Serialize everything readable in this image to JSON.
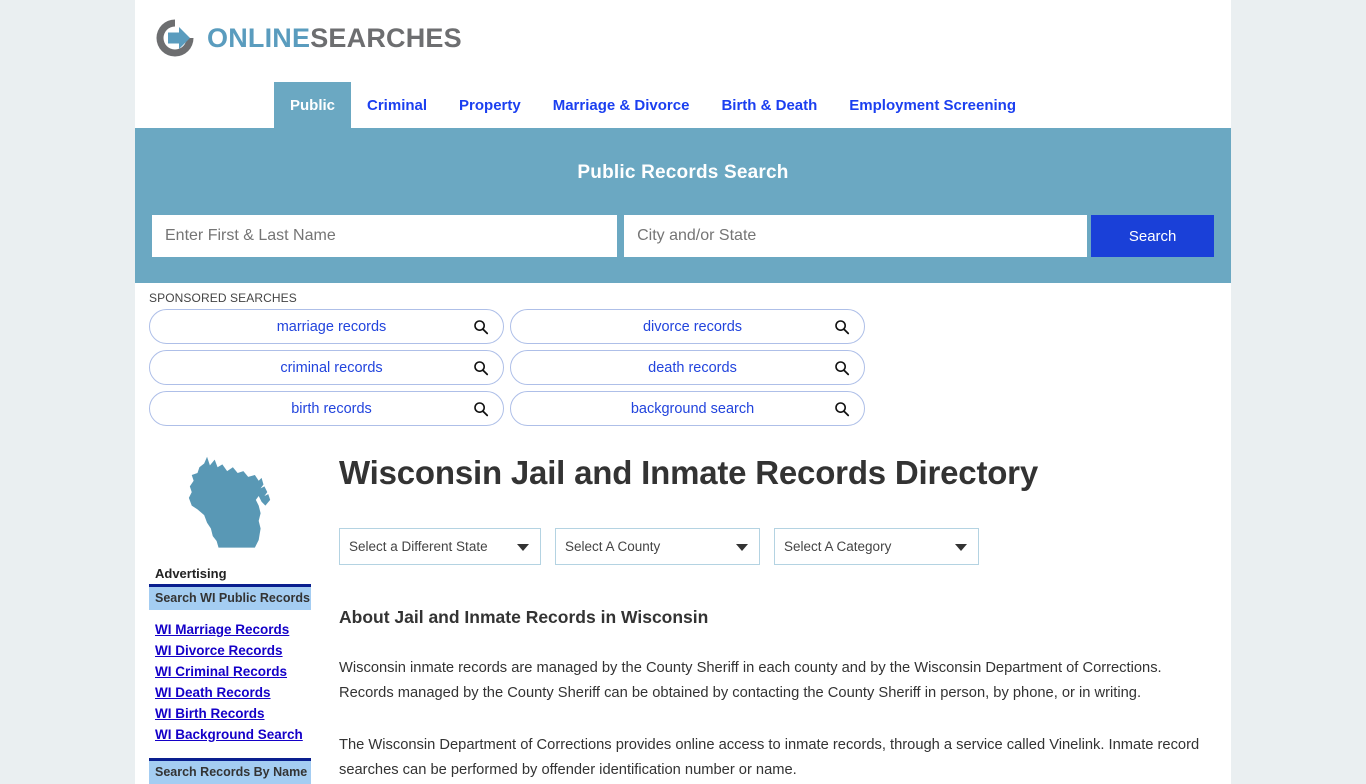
{
  "brand": {
    "name_primary": "ONLINE",
    "name_secondary": "SEARCHES",
    "logo_icon": "circle-arrow-logo"
  },
  "nav": {
    "tabs": [
      {
        "label": "Public",
        "active": true
      },
      {
        "label": "Criminal",
        "active": false
      },
      {
        "label": "Property",
        "active": false
      },
      {
        "label": "Marriage & Divorce",
        "active": false
      },
      {
        "label": "Birth & Death",
        "active": false
      },
      {
        "label": "Employment Screening",
        "active": false
      }
    ]
  },
  "search_banner": {
    "title": "Public Records Search",
    "name_value": "",
    "name_placeholder": "Enter First & Last Name",
    "city_value": "",
    "city_placeholder": "City and/or State",
    "button_label": "Search",
    "background_color": "#6ba8c2",
    "button_color": "#1a40d8"
  },
  "sponsored": {
    "label": "SPONSORED SEARCHES",
    "items": [
      {
        "label": "marriage records"
      },
      {
        "label": "divorce records"
      },
      {
        "label": "criminal records"
      },
      {
        "label": "death records"
      },
      {
        "label": "birth records"
      },
      {
        "label": "background search"
      }
    ]
  },
  "sidebar": {
    "state_icon": "wisconsin-state-map",
    "advertising_label": "Advertising",
    "header_1": "Search WI Public Records",
    "links": [
      {
        "label": "WI Marriage Records"
      },
      {
        "label": "WI Divorce Records"
      },
      {
        "label": "WI Criminal Records"
      },
      {
        "label": "WI Death Records"
      },
      {
        "label": "WI Birth Records"
      },
      {
        "label": "WI Background Search"
      }
    ],
    "header_2": "Search Records By Name"
  },
  "main": {
    "title": "Wisconsin Jail and Inmate Records Directory",
    "selectors": [
      {
        "label": "Select a Different State"
      },
      {
        "label": "Select A County"
      },
      {
        "label": "Select A Category"
      }
    ],
    "about_heading": "About Jail and Inmate Records in Wisconsin",
    "paragraph_1": "Wisconsin inmate records are managed by the County Sheriff in each county and by the Wisconsin Department of Corrections. Records managed by the County Sheriff can be obtained by contacting the County Sheriff in person, by phone, or in writing.",
    "paragraph_2": "The Wisconsin Department of Corrections provides online access to inmate records, through a service called Vinelink. Inmate record searches can be performed by offender identification number or name."
  },
  "colors": {
    "page_background": "#eaeff1",
    "accent_blue": "#6ba8c2",
    "link_blue": "#1400c8",
    "tab_blue": "#1b3ff0"
  }
}
